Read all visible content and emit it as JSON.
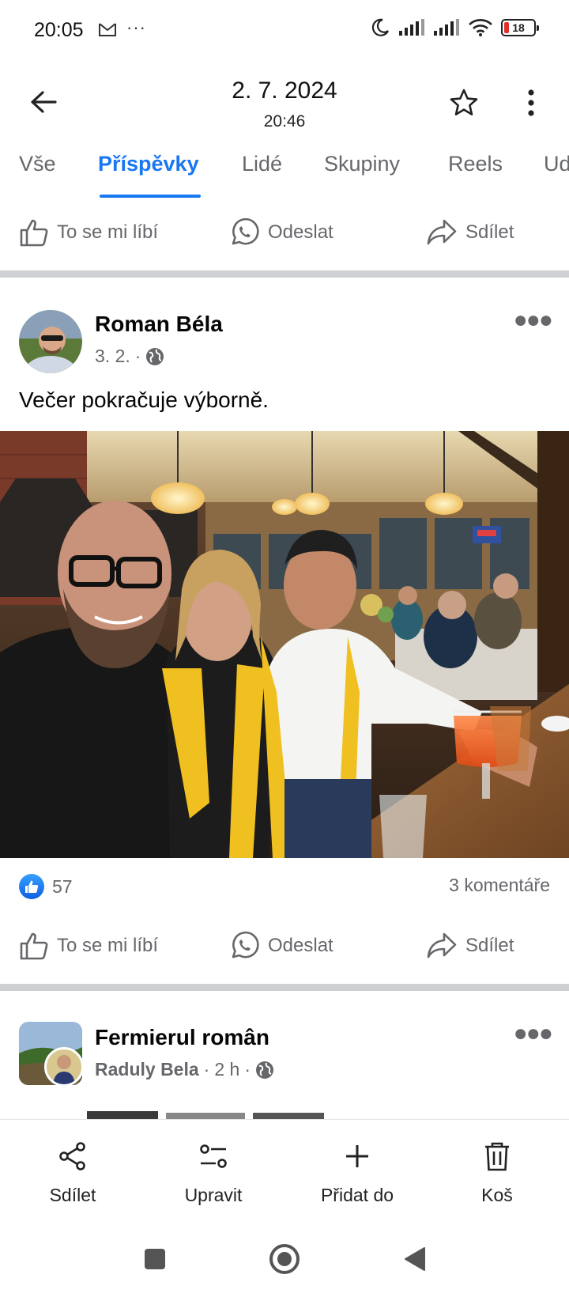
{
  "status_bar": {
    "time": "20:05",
    "notification_icons": [
      "gmail-icon",
      "more-notifications-icon"
    ],
    "more_indicator": "···",
    "battery_level": "18"
  },
  "header": {
    "date": "2. 7. 2024",
    "time": "20:46"
  },
  "tabs": [
    {
      "label": "Vše"
    },
    {
      "label": "Příspěvky"
    },
    {
      "label": "Lidé"
    },
    {
      "label": "Skupiny"
    },
    {
      "label": "Reels"
    },
    {
      "label": "Ud"
    }
  ],
  "active_tab": "Příspěvky",
  "actions": {
    "like": "To se mi líbí",
    "send": "Odeslat",
    "share": "Sdílet"
  },
  "post1": {
    "author": "Roman Béla",
    "date": "3. 2.",
    "separator": "·",
    "text": "Večer pokračuje výborně.",
    "likes": "57",
    "comments": "3 komentáře"
  },
  "post2": {
    "page_name": "Fermierul român",
    "author": "Raduly Bela",
    "time": "2 h",
    "separator": "·"
  },
  "toolbar": {
    "share": "Sdílet",
    "edit": "Upravit",
    "add_to": "Přidat do",
    "trash": "Koš"
  },
  "colors": {
    "accent": "#1877f2",
    "secondary_text": "#65676b",
    "divider": "#ced0d4"
  }
}
